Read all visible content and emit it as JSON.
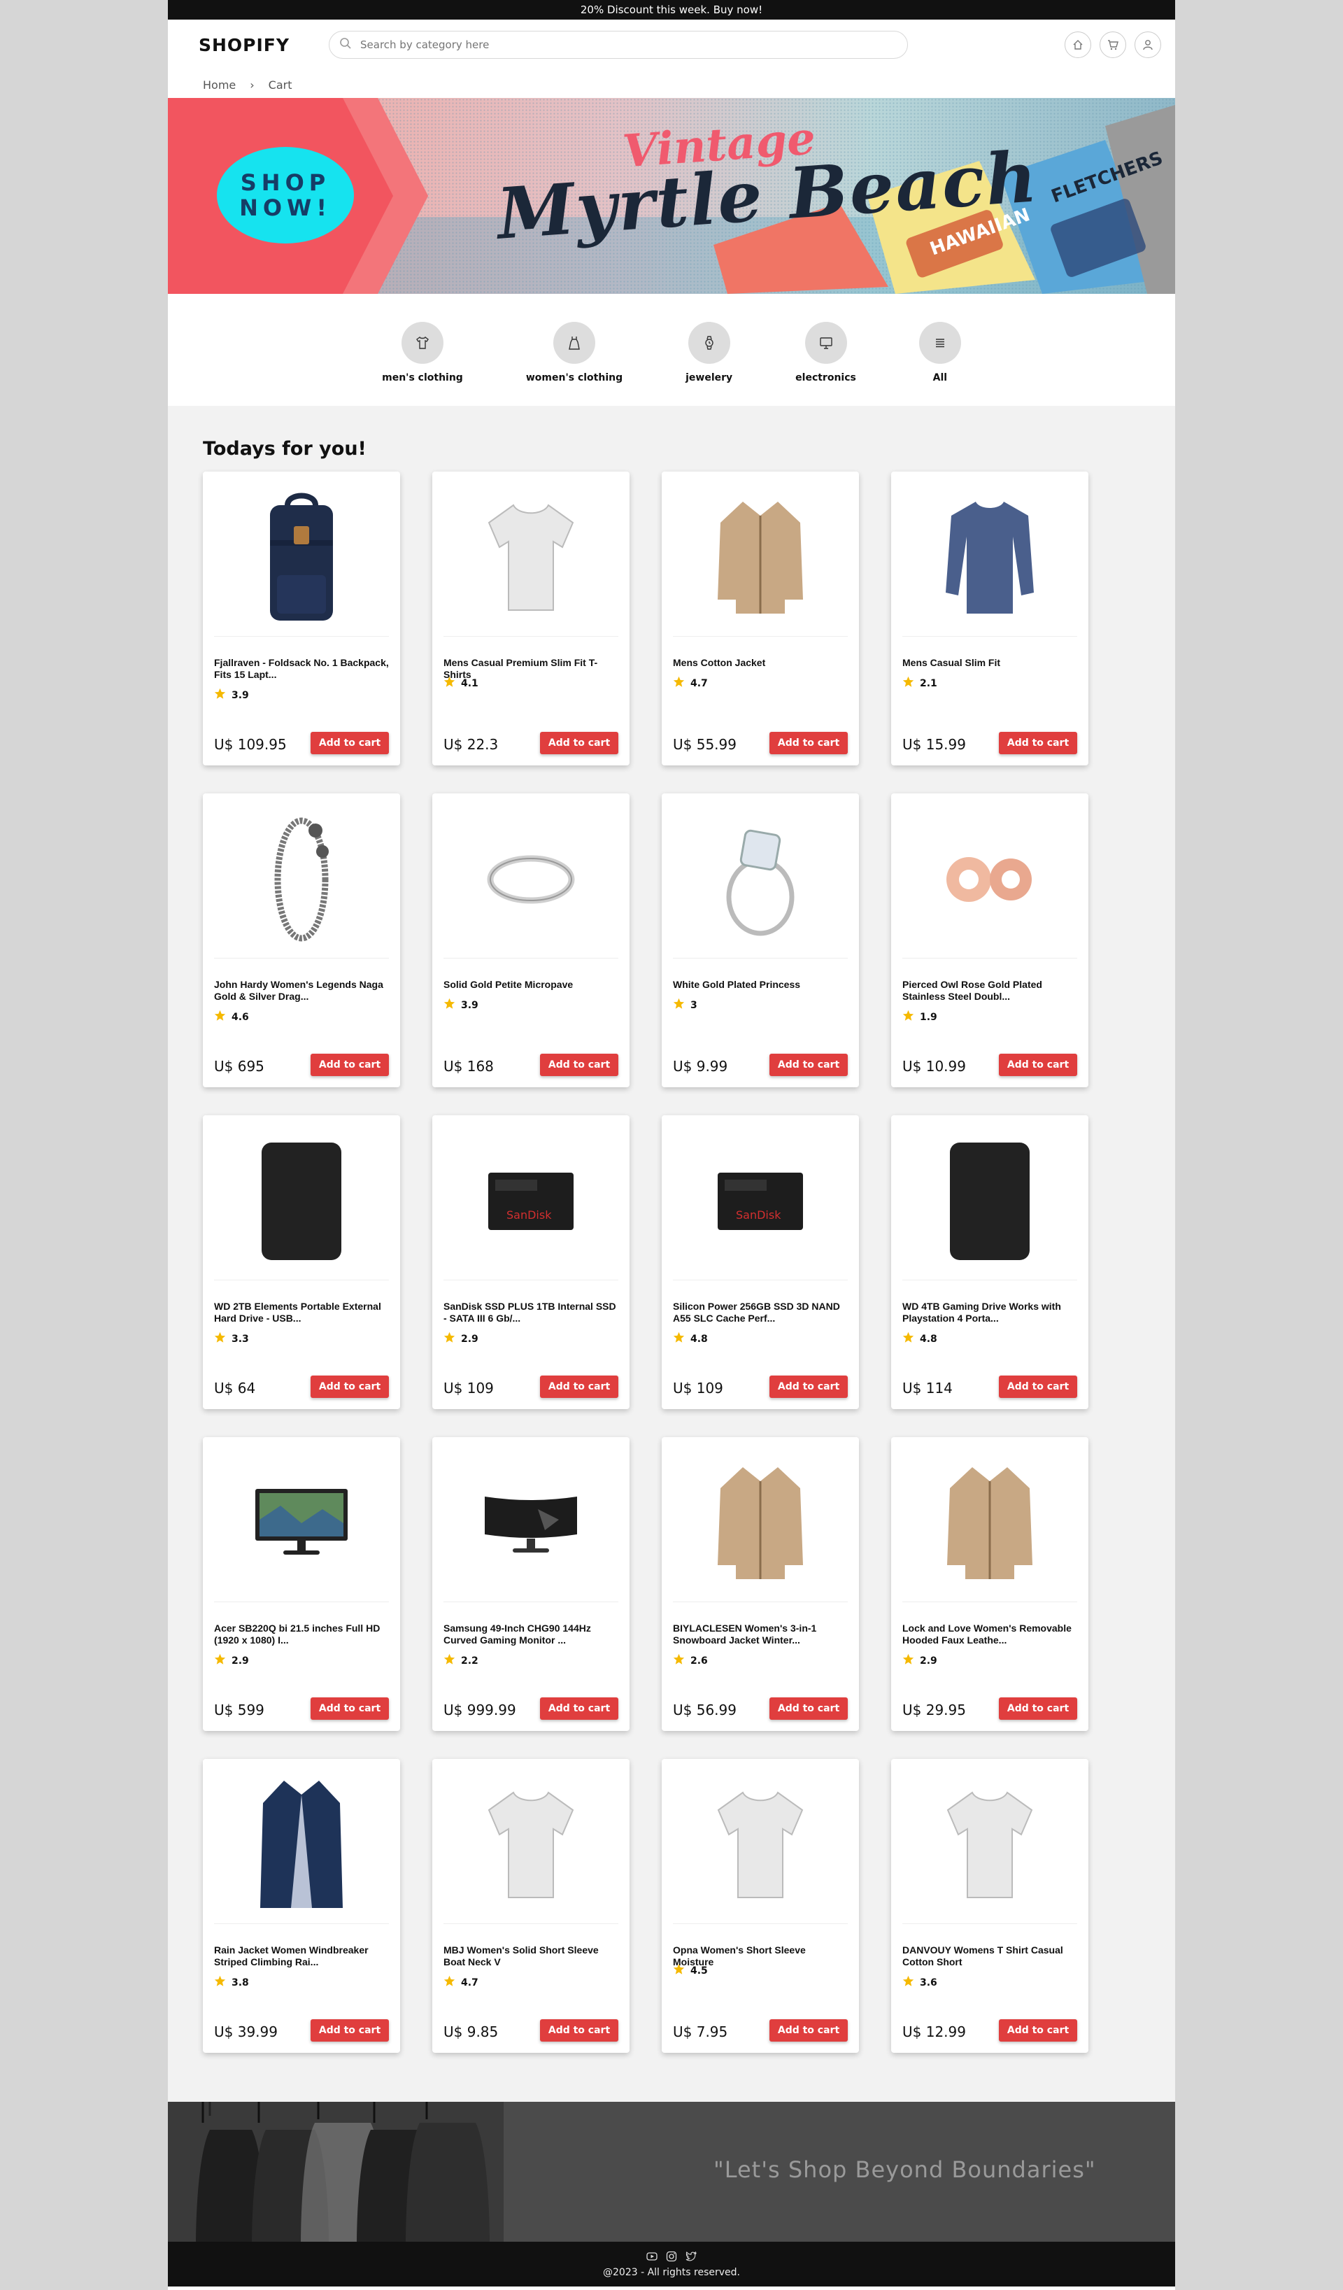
{
  "promo": "20% Discount this week. Buy now!",
  "header": {
    "logo": "SHOPIFY",
    "search_placeholder": "Search by category here"
  },
  "breadcrumb": [
    "Home",
    "›",
    "Cart"
  ],
  "hero": {
    "cta_line1": "SHOP",
    "cta_line2": "NOW!",
    "vintage": "Vintage",
    "script": "Myrtle Beach"
  },
  "categories": [
    {
      "label": "men's clothing",
      "icon": "tshirt-icon"
    },
    {
      "label": "women's clothing",
      "icon": "dress-icon"
    },
    {
      "label": "jewelery",
      "icon": "watch-icon"
    },
    {
      "label": "electronics",
      "icon": "monitor-icon"
    },
    {
      "label": "All",
      "icon": "list-icon"
    }
  ],
  "section_title": "Todays for you!",
  "add_to_cart_label": "Add to cart",
  "products": [
    {
      "title": "Fjallraven - Foldsack No. 1 Backpack, Fits 15 Lapt...",
      "rating": "3.9",
      "price": "U$ 109.95",
      "icon": "backpack-icon"
    },
    {
      "title": "Mens Casual Premium Slim Fit T-Shirts",
      "rating": "4.1",
      "price": "U$ 22.3",
      "icon": "tshirt-icon"
    },
    {
      "title": "Mens Cotton Jacket",
      "rating": "4.7",
      "price": "U$ 55.99",
      "icon": "jacket-icon"
    },
    {
      "title": "Mens Casual Slim Fit",
      "rating": "2.1",
      "price": "U$ 15.99",
      "icon": "longsleeve-icon"
    },
    {
      "title": "John Hardy Women's Legends Naga Gold & Silver Drag...",
      "rating": "4.6",
      "price": "U$ 695",
      "icon": "bracelet-icon"
    },
    {
      "title": "Solid Gold Petite Micropave",
      "rating": "3.9",
      "price": "U$ 168",
      "icon": "ring-icon"
    },
    {
      "title": "White Gold Plated Princess",
      "rating": "3",
      "price": "U$ 9.99",
      "icon": "diamond-ring-icon"
    },
    {
      "title": "Pierced Owl Rose Gold Plated Stainless Steel Doubl...",
      "rating": "1.9",
      "price": "U$ 10.99",
      "icon": "earrings-icon"
    },
    {
      "title": "WD 2TB Elements Portable External Hard Drive - USB...",
      "rating": "3.3",
      "price": "U$ 64",
      "icon": "hard-drive-icon"
    },
    {
      "title": "SanDisk SSD PLUS 1TB Internal SSD - SATA III 6 Gb/...",
      "rating": "2.9",
      "price": "U$ 109",
      "icon": "ssd-icon"
    },
    {
      "title": "Silicon Power 256GB SSD 3D NAND A55 SLC Cache Perf...",
      "rating": "4.8",
      "price": "U$ 109",
      "icon": "ssd-icon"
    },
    {
      "title": "WD 4TB Gaming Drive Works with Playstation 4 Porta...",
      "rating": "4.8",
      "price": "U$ 114",
      "icon": "hard-drive-icon"
    },
    {
      "title": "Acer SB220Q bi 21.5 inches Full HD (1920 x 1080) I...",
      "rating": "2.9",
      "price": "U$ 599",
      "icon": "monitor-icon"
    },
    {
      "title": "Samsung 49-Inch CHG90 144Hz Curved Gaming Monitor ...",
      "rating": "2.2",
      "price": "U$ 999.99",
      "icon": "curved-monitor-icon"
    },
    {
      "title": "BIYLACLESEN Women's 3-in-1 Snowboard Jacket Winter...",
      "rating": "2.6",
      "price": "U$ 56.99",
      "icon": "jacket-icon"
    },
    {
      "title": "Lock and Love Women's Removable Hooded Faux Leathe...",
      "rating": "2.9",
      "price": "U$ 29.95",
      "icon": "jacket-icon"
    },
    {
      "title": "Rain Jacket Women Windbreaker Striped Climbing Rai...",
      "rating": "3.8",
      "price": "U$ 39.99",
      "icon": "coat-icon"
    },
    {
      "title": "MBJ Women's Solid Short Sleeve Boat Neck V",
      "rating": "4.7",
      "price": "U$ 9.85",
      "icon": "tshirt-icon"
    },
    {
      "title": "Opna Women's Short Sleeve Moisture",
      "rating": "4.5",
      "price": "U$ 7.95",
      "icon": "tshirt-icon"
    },
    {
      "title": "DANVOUY Womens T Shirt Casual Cotton Short",
      "rating": "3.6",
      "price": "U$ 12.99",
      "icon": "tshirt-icon"
    }
  ],
  "quote": "\"Let's Shop Beyond Boundaries\"",
  "footer": {
    "copyright": "@2023 - All rights reserved.",
    "social": [
      "youtube-icon",
      "instagram-icon",
      "twitter-icon"
    ]
  },
  "colors": {
    "accent": "#e03e3e",
    "hero_cta": "#16e3ef",
    "star": "#f5b900"
  }
}
